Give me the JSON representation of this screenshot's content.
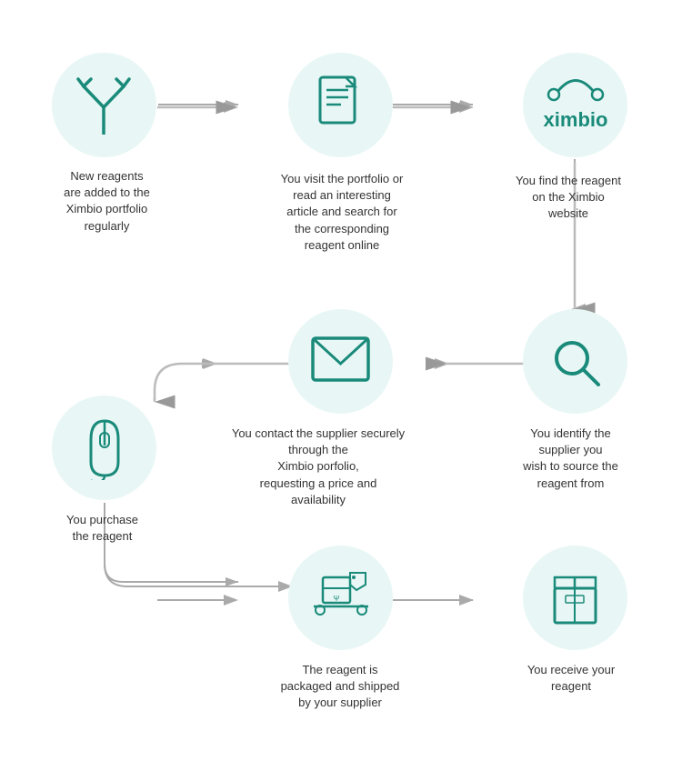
{
  "circles": {
    "c1": {
      "label": "New reagents\nare added to the\nXimbio portfolio\nregularly"
    },
    "c2": {
      "label": "You visit the portfolio or\nread an interesting\narticle and search for\nthe corresponding\nreagent online"
    },
    "c3": {
      "label": "You find the reagent\non the Ximbio\nwebsite"
    },
    "c4": {
      "label": "You identify the\nsupplier you\nwish to source the\nreagent from"
    },
    "c5": {
      "label": "You contact the supplier securely\nthrough the\nXimbio porfolio,\nrequesting a price and\navailability"
    },
    "c6": {
      "label": "You purchase\nthe reagent"
    },
    "c7": {
      "label": "The reagent is\npackaged and shipped\nby your supplier"
    },
    "c8": {
      "label": "You receive your\nreagent"
    }
  }
}
